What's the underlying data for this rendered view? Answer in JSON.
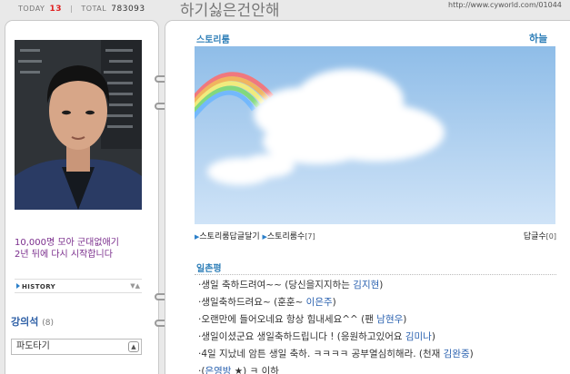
{
  "header": {
    "today_label": "TODAY",
    "today_count": "13",
    "total_label": "TOTAL",
    "total_count": "783093",
    "title": "하기싫은건안해",
    "url": "http://www.cyworld.com/01044"
  },
  "profile": {
    "intro_line1": "10,000명 모아 군대없애기",
    "intro_line2": "2년 뒤에 다시 시작합니다",
    "history_label": "HISTORY",
    "owner_name": "강의석",
    "owner_badge": "(8)",
    "dropdown_value": "파도타기"
  },
  "story": {
    "title": "스토리룸",
    "weather": "하늘",
    "link_comments": "스토리룸답글달기",
    "link_count_label": "스토리룸수",
    "link_count": "[7]",
    "reply_count_label": "답글수",
    "reply_count": "[0]"
  },
  "guestbook": {
    "title": "일촌평",
    "entries": [
      {
        "text": "·생일 축하드려여~~ (당신을지지하는 ",
        "name": "김지현",
        "suffix": ")"
      },
      {
        "text": "·생일축하드려요~ (훈훈~ ",
        "name": "이은주",
        "suffix": ")"
      },
      {
        "text": "·오랜만에 들어오네요 항상 힘내세요^^ (팬 ",
        "name": "남현우",
        "suffix": ")"
      },
      {
        "text": "·생일이셨군요 생일축하드립니다 ! (응원하고있어요 ",
        "name": "김미나",
        "suffix": ")"
      },
      {
        "text": "·4일 지났네 암튼 생일 축하. ㅋㅋㅋㅋ 공부열심히해라. (천재 ",
        "name": "김완중",
        "suffix": ")"
      },
      {
        "text": "·(",
        "name": "은영방",
        "suffix": " ★) ㅋ 이하"
      }
    ]
  }
}
